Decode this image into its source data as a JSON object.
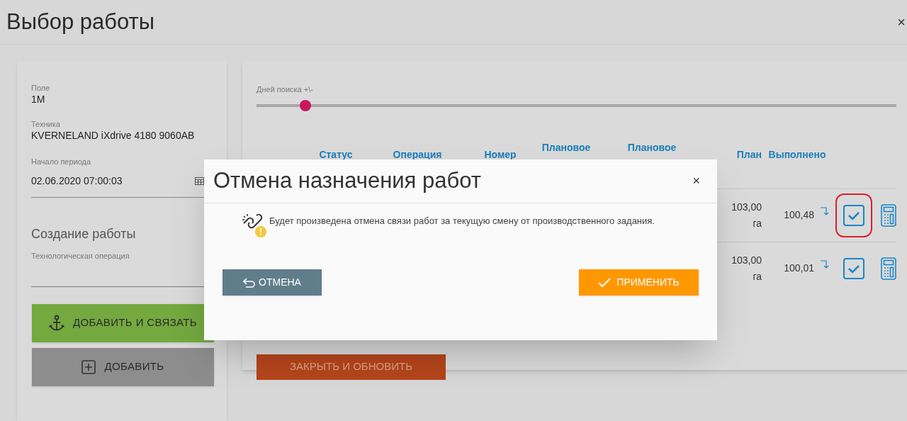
{
  "window": {
    "title": "Выбор работы",
    "close": "×"
  },
  "left_panel": {
    "fields": [
      {
        "kind": "info",
        "label": "Поле",
        "value": "1M"
      },
      {
        "kind": "info",
        "label": "Техника",
        "value": "KVERNELAND iXdrive 4180 9060AB"
      },
      {
        "kind": "date",
        "label": "Начало периода",
        "value": "02.06.2020 07:00:03"
      }
    ],
    "section_title": "Создание работы",
    "select": {
      "label": "Технологическая операция"
    },
    "buttons": [
      {
        "kind": "link",
        "label": "ДОБАВИТЬ И СВЯЗАТЬ"
      },
      {
        "kind": "add",
        "label": "ДОБАВИТЬ"
      }
    ]
  },
  "right_panel": {
    "slider": {
      "label": "Дней поиска +\\-",
      "level": 0.076
    },
    "table": {
      "columns": [
        "Статус",
        "Операция",
        "Номер",
        "Плановое",
        "Плановое",
        "План",
        "Выполнено"
      ],
      "rows": [
        {
          "plan": "103,00",
          "plan_unit": "га",
          "done": "100,48",
          "highlighted": true
        },
        {
          "plan": "103,00",
          "plan_unit": "га",
          "done": "100,01",
          "highlighted": false
        }
      ]
    },
    "close_button": "ЗАКРЫТЬ И ОБНОВИТЬ"
  },
  "dialog": {
    "title": "Отмена назначения работ",
    "close": "×",
    "message": "Будет произведена отмена связи работ за текущую смену от производственного задания.",
    "buttons": [
      {
        "kind": "cancel",
        "label": "ОТМЕНА"
      },
      {
        "kind": "apply",
        "label": "ПРИМЕНИТЬ"
      }
    ]
  }
}
